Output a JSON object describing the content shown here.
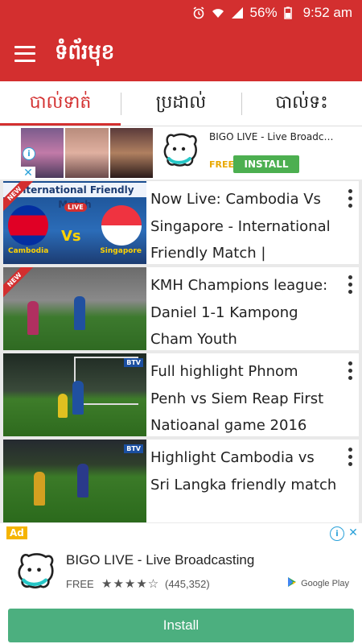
{
  "status_bar": {
    "battery": "56%",
    "time": "9:52 am",
    "icons": [
      "alarm-icon",
      "wifi-icon",
      "signal-icon",
      "battery-icon"
    ]
  },
  "app_bar": {
    "title": "ទំព័រមុខ",
    "menu_icon": "menu-icon"
  },
  "tabs": [
    {
      "label": "បាល់ទាត់",
      "active": true
    },
    {
      "label": "ប្រដាល់",
      "active": false
    },
    {
      "label": "បាល់ទះ",
      "active": false
    }
  ],
  "banner_ad": {
    "title": "BIGO LIVE - Live Broadca...",
    "free_label": "FREE",
    "install_label": "INSTALL"
  },
  "videos": [
    {
      "title": "Now Live: Cambodia Vs Singapore - International Friendly Match |",
      "thumb_header": "International Friendly Match",
      "team_left": "Cambodia",
      "team_right": "Singapore",
      "vs": "Vs",
      "live": "LIVE",
      "badge": "NEW"
    },
    {
      "title": "KMH Champions league: Daniel 1-1 Kampong Cham Youth",
      "badge": "NEW"
    },
    {
      "title": "Full highlight Phnom Penh vs Siem Reap First Natioanal game 2016",
      "channel": "BTV"
    },
    {
      "title": "Highlight Cambodia vs Sri Langka friendly match",
      "channel": "BTV"
    }
  ],
  "native_ad": {
    "badge": "Ad",
    "title": "BIGO LIVE - Live Broadcasting",
    "free_label": "FREE",
    "stars": "★★★★☆",
    "rating_count": "(445,352)",
    "store_label": "Google Play",
    "install_label": "Install"
  },
  "colors": {
    "primary": "#d32f2f",
    "install_green": "#4caf50",
    "ad_yellow": "#f5b400"
  }
}
